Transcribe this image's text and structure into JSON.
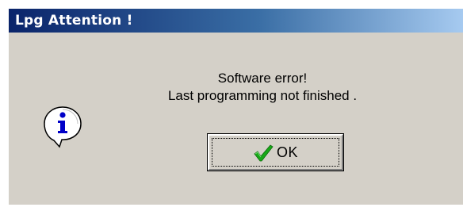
{
  "window": {
    "title": "Lpg Attention !"
  },
  "message": {
    "line1": "Software error!",
    "line2": "Last programming not finished ."
  },
  "buttons": {
    "ok_label": "OK"
  },
  "icons": {
    "message_icon": "information-icon",
    "ok_icon": "checkmark-icon"
  },
  "colors": {
    "titlebar_start": "#0a246a",
    "titlebar_end": "#a6caf0",
    "dialog_background": "#d4d0c8",
    "info_icon_blue": "#0000c8",
    "checkmark_green": "#18a818"
  }
}
